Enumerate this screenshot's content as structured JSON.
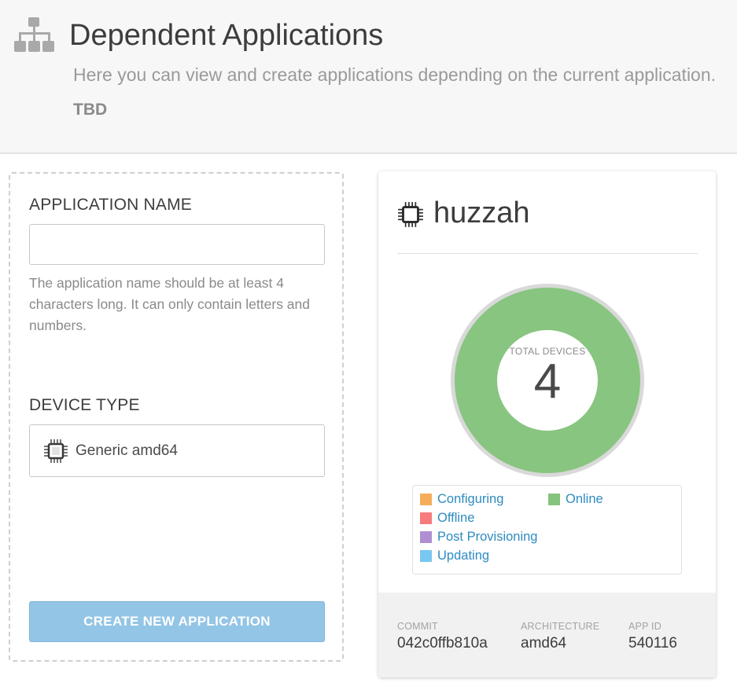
{
  "header": {
    "title": "Dependent Applications",
    "subtitle": "Here you can view and create applications depending on the current application.",
    "note": "TBD",
    "icon": "sitemap-icon"
  },
  "form": {
    "name_label": "APPLICATION NAME",
    "name_value": "",
    "name_placeholder": "",
    "help_text": "The application name should be at least 4 characters long. It can only contain letters and numbers.",
    "device_label": "DEVICE TYPE",
    "device_value": "Generic amd64",
    "device_icon": "chip-icon",
    "create_label": "CREATE NEW APPLICATION"
  },
  "app": {
    "name": "huzzah",
    "icon": "chip-icon",
    "total_label": "TOTAL DEVICES",
    "total_value": "4",
    "status_fractions": {
      "online": 1.0
    },
    "legend": [
      {
        "label": "Configuring",
        "color": "#f5ad5c"
      },
      {
        "label": "Online",
        "color": "#85c47c"
      },
      {
        "label": "Offline",
        "color": "#f77b7b"
      },
      {
        "label": "Post Provisioning",
        "color": "#b08fd1"
      },
      {
        "label": "Updating",
        "color": "#7ac7f2"
      }
    ],
    "meta": [
      {
        "key": "COMMIT",
        "value": "042c0ffb810a"
      },
      {
        "key": "ARCHITECTURE",
        "value": "amd64"
      },
      {
        "key": "APP ID",
        "value": "540116"
      }
    ]
  },
  "colors": {
    "accent_link": "#2e8bc0",
    "button_disabled": "#93c5e6",
    "donut_online": "#88c580",
    "donut_ring": "#d9d9d9"
  }
}
